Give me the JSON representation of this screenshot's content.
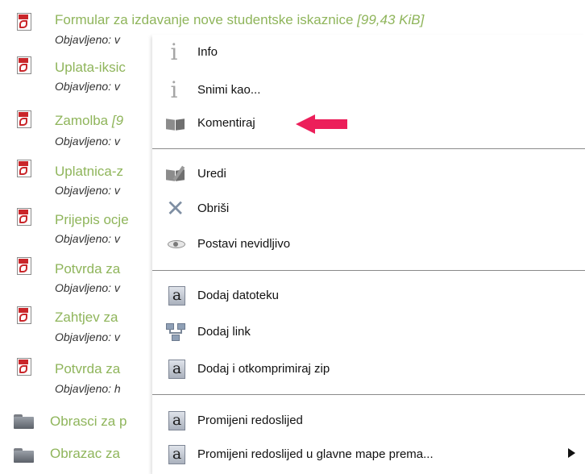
{
  "files": [
    {
      "name": "Formular za izdavanje nove studentske iskaznice",
      "size": "[99,43 KiB]",
      "meta": "Objavljeno: v"
    },
    {
      "name": "Uplata-iksic",
      "size": "",
      "meta": "Objavljeno: v"
    },
    {
      "name": "Zamolba",
      "size": "[9",
      "meta": "Objavljeno: v"
    },
    {
      "name": "Uplatnica-z",
      "size": "",
      "meta": "Objavljeno: v"
    },
    {
      "name": "Prijepis ocje",
      "size": "",
      "meta": "Objavljeno: v"
    },
    {
      "name": "Potvrda za",
      "size": "",
      "meta": "Objavljeno: v"
    },
    {
      "name": "Zahtjev za",
      "size": "",
      "meta": "Objavljeno: v"
    },
    {
      "name": "Potvrda za",
      "size": "",
      "meta": "Objavljeno: h"
    }
  ],
  "folders": [
    {
      "name": "Obrasci za p"
    },
    {
      "name": "Obrazac za"
    }
  ],
  "context_menu": {
    "items": [
      {
        "label": "Info",
        "icon": "info-icon"
      },
      {
        "label": "Snimi kao...",
        "icon": "info-icon"
      },
      {
        "label": "Komentiraj",
        "icon": "book-icon"
      },
      {
        "label": "Uredi",
        "icon": "edit-icon"
      },
      {
        "label": "Obriši",
        "icon": "delete-x-icon"
      },
      {
        "label": "Postavi nevidljivo",
        "icon": "eye-icon"
      },
      {
        "label": "Dodaj datoteku",
        "icon": "add-file-icon"
      },
      {
        "label": "Dodaj link",
        "icon": "network-link-icon"
      },
      {
        "label": "Dodaj i otkomprimiraj zip",
        "icon": "add-file-icon"
      },
      {
        "label": "Promijeni redoslijed",
        "icon": "add-file-icon"
      },
      {
        "label": "Promijeni redoslijed u glavne mape prema...",
        "icon": "add-file-icon",
        "has_submenu": true
      }
    ]
  },
  "colors": {
    "link": "#8fb55b",
    "annotation_arrow": "#ec1f5a",
    "separator": "#8a8a8a"
  }
}
